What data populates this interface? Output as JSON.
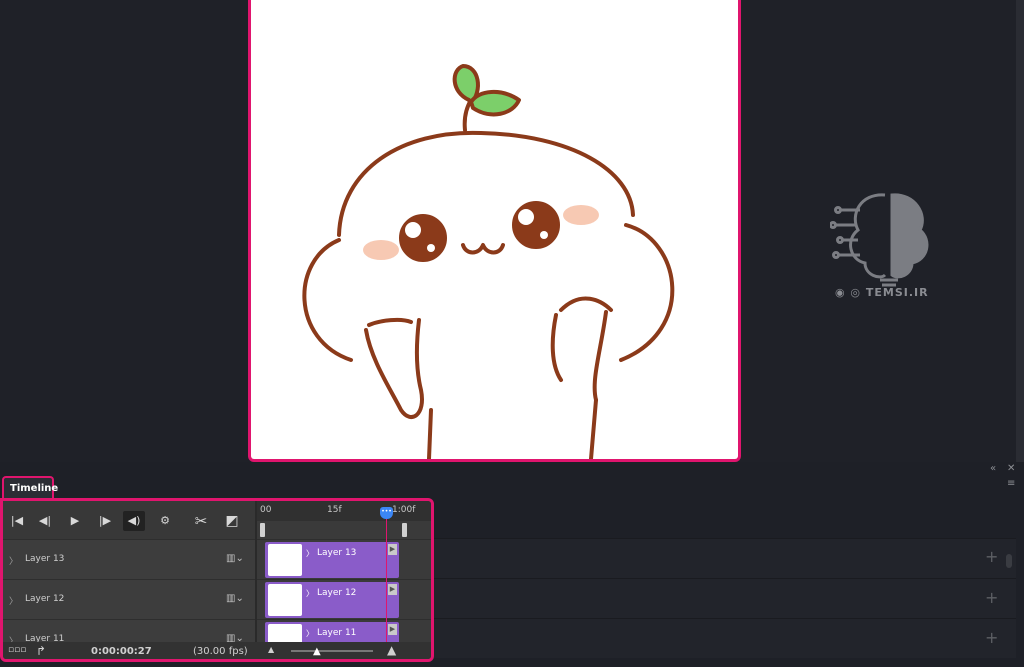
{
  "document": {
    "description_colors": {
      "border": "#e0156e",
      "line": "#8b3a1a",
      "leaf": "#7ccf6a",
      "blush": "#f7c9b3"
    }
  },
  "watermark": {
    "text": "TEMSI.IR"
  },
  "panel": {
    "controls": {
      "collapse": "«",
      "close": "✕",
      "menu": "≡"
    }
  },
  "timeline": {
    "tab_label": "Timeline",
    "toolbar": {
      "first_frame": "|◀",
      "prev_frame": "◀|",
      "play": "▶",
      "next_frame": "|▶",
      "audio": "◀)",
      "settings": "⚙",
      "split": "✂",
      "transition": "◩"
    },
    "ruler": {
      "start": "00",
      "mid": "15f",
      "end": "1:00f"
    },
    "layers": [
      {
        "name": "Layer 13",
        "clip_label": "Layer 13"
      },
      {
        "name": "Layer 12",
        "clip_label": "Layer 12"
      },
      {
        "name": "Layer 11",
        "clip_label": "Layer 11"
      }
    ],
    "footer": {
      "timecode": "0:00:00:27",
      "fps": "(30.00 fps)"
    },
    "colors": {
      "clip": "#8a5cc9",
      "playhead": "#e0156e",
      "knob": "#3b86f5"
    }
  }
}
